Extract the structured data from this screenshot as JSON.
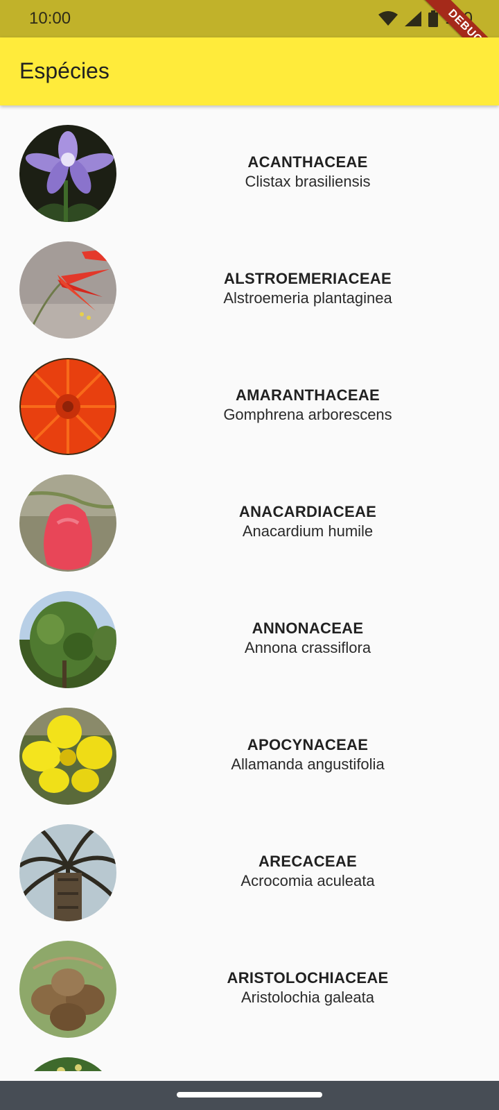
{
  "status_bar": {
    "time": "10:00",
    "battery": "100",
    "icons": [
      "wifi-icon",
      "cell-signal-icon",
      "battery-icon"
    ]
  },
  "debug_banner": "DEBUG",
  "app_bar": {
    "title": "Espécies",
    "color": "#ffeb3b"
  },
  "species": [
    {
      "family": "ACANTHACEAE",
      "name": "Clistax brasiliensis"
    },
    {
      "family": "ALSTROEMERIACEAE",
      "name": "Alstroemeria plantaginea"
    },
    {
      "family": "AMARANTHACEAE",
      "name": "Gomphrena arborescens"
    },
    {
      "family": "ANACARDIACEAE",
      "name": "Anacardium humile"
    },
    {
      "family": "ANNONACEAE",
      "name": "Annona crassiflora"
    },
    {
      "family": "APOCYNACEAE",
      "name": "Allamanda angustifolia"
    },
    {
      "family": "ARECACEAE",
      "name": "Acrocomia aculeata"
    },
    {
      "family": "ARISTOLOCHIACEAE",
      "name": "Aristolochia galeata"
    }
  ]
}
